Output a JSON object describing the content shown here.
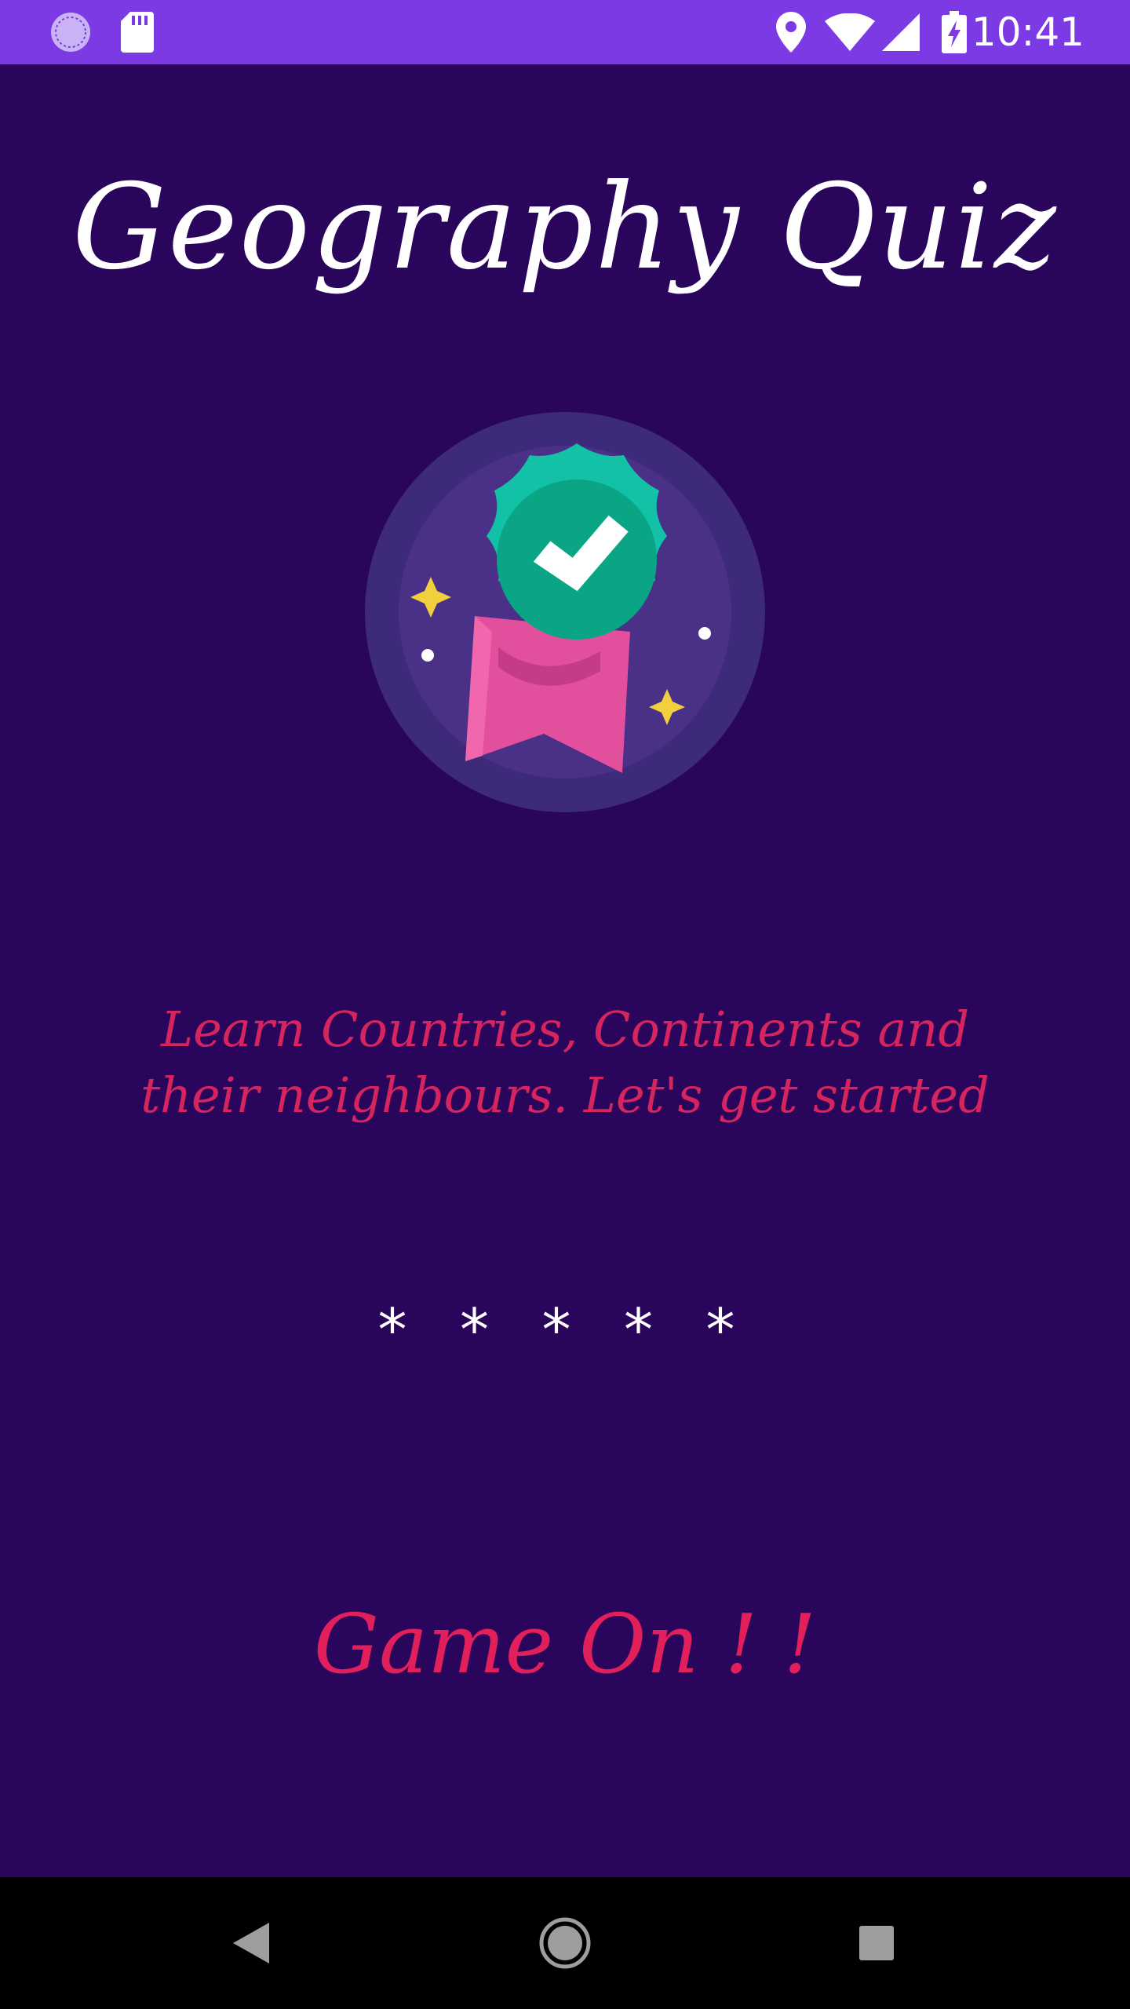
{
  "status_bar": {
    "time": "10:41",
    "icons": [
      "sync-icon",
      "sd-card-icon",
      "location-icon",
      "wifi-icon",
      "signal-icon",
      "battery-charging-icon"
    ],
    "background": "#7b3ae3"
  },
  "main": {
    "title": "Geography Quiz",
    "badge_icon": "award-badge-icon",
    "tagline": "Learn Countries, Continents and their neighbours. Let's get started",
    "rating": "* * * * *",
    "start_button": "Game On ! !",
    "background": "#2a055c",
    "accent": "#e01f5b"
  },
  "nav_bar": {
    "icons": [
      "back-icon",
      "home-icon",
      "recents-icon"
    ]
  }
}
